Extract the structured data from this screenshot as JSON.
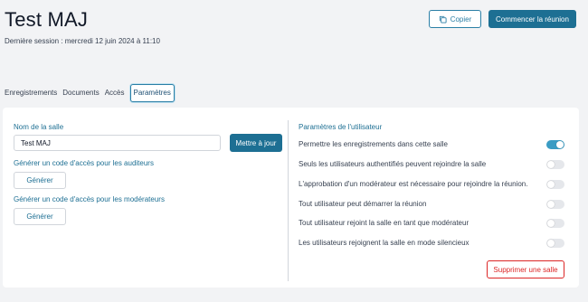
{
  "header": {
    "title": "Test MAJ",
    "subtitle": "Dernière session : mercredi 12 juin 2024 à 11:10",
    "copy_label": "Copier",
    "start_label": "Commencer la réunion"
  },
  "tabs": [
    {
      "label": "Enregistrements",
      "active": false
    },
    {
      "label": "Documents",
      "active": false
    },
    {
      "label": "Accès",
      "active": false
    },
    {
      "label": "Paramètres",
      "active": true
    }
  ],
  "left": {
    "room_name_label": "Nom de la salle",
    "room_name_value": "Test MAJ",
    "update_label": "Mettre à jour",
    "viewer_code_label": "Générer un code d'accès pour les auditeurs",
    "viewer_generate_label": "Générer",
    "moderator_code_label": "Générer un code d'accès pour les modérateurs",
    "moderator_generate_label": "Générer"
  },
  "right": {
    "heading": "Paramètres de l'utilisateur",
    "settings": [
      {
        "label": "Permettre les enregistrements dans cette salle",
        "enabled": true
      },
      {
        "label": "Seuls les utilisateurs authentifiés peuvent rejoindre la salle",
        "enabled": false
      },
      {
        "label": "L'approbation d'un modérateur est nécessaire pour rejoindre la réunion.",
        "enabled": false
      },
      {
        "label": "Tout utilisateur peut démarrer la réunion",
        "enabled": false
      },
      {
        "label": "Tout utilisateur rejoint la salle en tant que modérateur",
        "enabled": false
      },
      {
        "label": "Les utilisateurs rejoignent la salle en mode silencieux",
        "enabled": false
      }
    ],
    "delete_label": "Supprimer une salle"
  },
  "icons": {
    "copy": "copy-icon"
  },
  "colors": {
    "primary": "#1d6f93",
    "toggle_on": "#3a9cc4",
    "danger": "#dc2626",
    "background": "#f2f3f5"
  }
}
